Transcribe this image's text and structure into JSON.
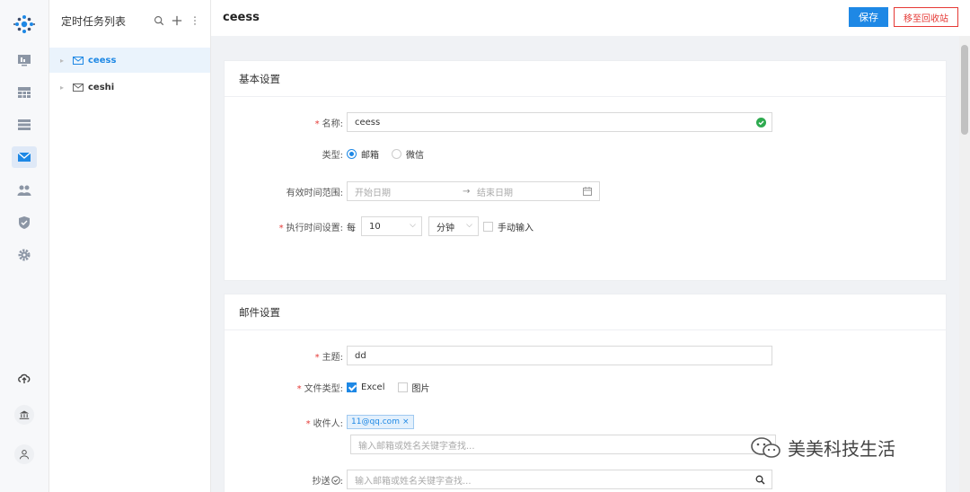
{
  "task_panel": {
    "title": "定时任务列表",
    "items": [
      {
        "label": "ceess",
        "selected": true
      },
      {
        "label": "ceshi",
        "selected": false
      }
    ]
  },
  "header": {
    "title": "ceess",
    "save_label": "保存",
    "trash_label": "移至回收站"
  },
  "basic": {
    "title": "基本设置",
    "name_label": "名称:",
    "name_value": "ceess",
    "type_label": "类型:",
    "type_options": [
      "邮箱",
      "微信"
    ],
    "type_selected": "邮箱",
    "range_label": "有效时间范围:",
    "range_start_placeholder": "开始日期",
    "range_end_placeholder": "结束日期",
    "exec_label": "执行时间设置:",
    "exec_every": "每",
    "exec_value": "10",
    "exec_unit": "分钟",
    "manual_label": "手动输入"
  },
  "mail": {
    "title": "邮件设置",
    "subject_label": "主题:",
    "subject_value": "dd",
    "filetype_label": "文件类型:",
    "filetype_options": [
      {
        "label": "Excel",
        "checked": true
      },
      {
        "label": "图片",
        "checked": false
      }
    ],
    "recipient_label": "收件人:",
    "recipient_tag": "11@qq.com",
    "recipient_placeholder": "输入邮箱或姓名关键字查找...",
    "cc_label": "抄送",
    "cc_placeholder": "输入邮箱或姓名关键字查找..."
  },
  "watermark": "美美科技生活",
  "colors": {
    "accent": "#1e88e5",
    "danger": "#e53935",
    "ok": "#2eaa4f"
  }
}
